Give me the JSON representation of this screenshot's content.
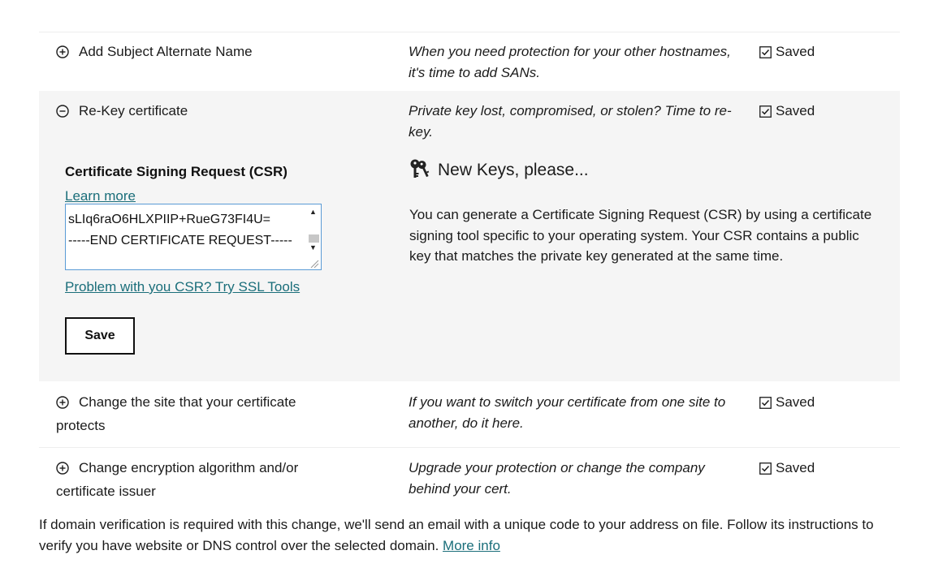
{
  "rows": {
    "san": {
      "title": "Add Subject Alternate Name",
      "description": "When you need protection for your other hostnames, it's time to add SANs.",
      "status": "Saved"
    },
    "rekey": {
      "title": "Re-Key certificate",
      "description": "Private key lost, compromised, or stolen? Time to re-key.",
      "status": "Saved"
    },
    "site": {
      "title": "Change the site that your certificate protects",
      "description": "If you want to switch your certificate from one site to another, do it here.",
      "status": "Saved"
    },
    "algo": {
      "title": "Change encryption algorithm and/or certificate issuer",
      "description": "Upgrade your protection or change the company behind your cert.",
      "status": "Saved"
    }
  },
  "rekey_panel": {
    "csr_label": "Certificate Signing Request (CSR)",
    "learn_more": "Learn more",
    "csr_value": "sLIq6raO6HLXPIIP+RueG73FI4U=\n-----END CERTIFICATE REQUEST-----",
    "ssl_tools_link": "Problem with you CSR? Try SSL Tools",
    "save_label": "Save",
    "keys_title": "New Keys, please...",
    "keys_body": "You can generate a Certificate Signing Request (CSR) by using a certificate signing tool specific to your operating system. Your CSR contains a public key that matches the private key generated at the same time."
  },
  "footer": {
    "text": "If domain verification is required with this change, we'll send an email with a unique code to your address on file. Follow its instructions to verify you have website or DNS control over the selected domain.",
    "more_info": "More info"
  },
  "icons": {
    "expand": "plus-circle-icon",
    "collapse": "minus-circle-icon",
    "status": "checkbox-checked-icon",
    "keys": "keys-icon"
  },
  "colors": {
    "link": "#1a6e7a",
    "panel_bg": "#f5f5f5",
    "textarea_border": "#5a9bd5"
  }
}
